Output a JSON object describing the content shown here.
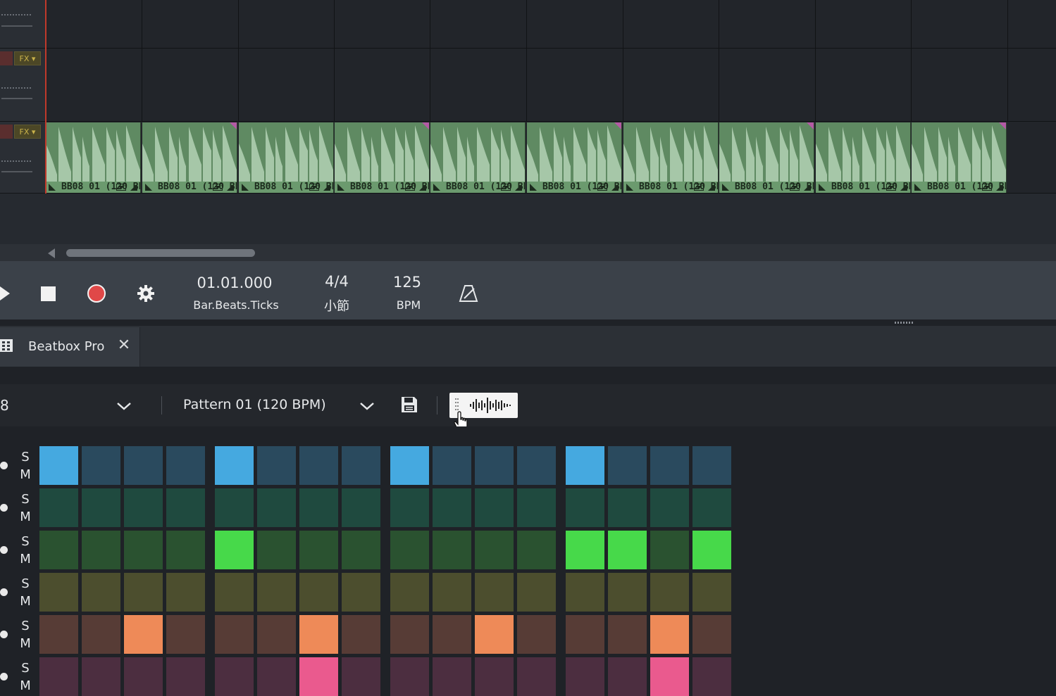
{
  "arranger": {
    "clip_label": "BB08 01 (120 BPM)...",
    "clip_count": 10,
    "fx_label": "FX"
  },
  "transport": {
    "position_value": "01.01.000",
    "position_label": "Bar.Beats.Ticks",
    "meter_value": "4/4",
    "meter_label": "小節",
    "tempo_value": "125",
    "tempo_label": "BPM"
  },
  "instrument": {
    "tab_label": "Beatbox Pro",
    "tab_close": "✕",
    "kit_value": "8",
    "pattern_value": "Pattern 01 (120 BPM)"
  },
  "sequencer": {
    "solo_label": "S",
    "mute_label": "M",
    "rows": [
      {
        "on": "#45a9e0",
        "off": "#2a4a5e",
        "steps": [
          1,
          0,
          0,
          0,
          1,
          0,
          0,
          0,
          1,
          0,
          0,
          0,
          1,
          0,
          0,
          0
        ]
      },
      {
        "on": "#2f6e58",
        "off": "#1f4a3f",
        "steps": [
          0,
          0,
          0,
          0,
          0,
          0,
          0,
          0,
          0,
          0,
          0,
          0,
          0,
          0,
          0,
          0
        ]
      },
      {
        "on": "#47d94a",
        "off": "#2a5230",
        "steps": [
          0,
          0,
          0,
          0,
          1,
          0,
          0,
          0,
          0,
          0,
          0,
          0,
          1,
          1,
          0,
          1
        ]
      },
      {
        "on": "#8a8440",
        "off": "#4c4e2e",
        "steps": [
          0,
          0,
          0,
          0,
          0,
          0,
          0,
          0,
          0,
          0,
          0,
          0,
          0,
          0,
          0,
          0
        ]
      },
      {
        "on": "#ee8a58",
        "off": "#573c36",
        "steps": [
          0,
          0,
          1,
          0,
          0,
          0,
          1,
          0,
          0,
          0,
          1,
          0,
          0,
          0,
          1,
          0
        ]
      },
      {
        "on": "#ea5a8e",
        "off": "#4c2e40",
        "steps": [
          0,
          0,
          0,
          0,
          0,
          0,
          1,
          0,
          0,
          0,
          0,
          0,
          0,
          0,
          1,
          0
        ]
      }
    ]
  }
}
